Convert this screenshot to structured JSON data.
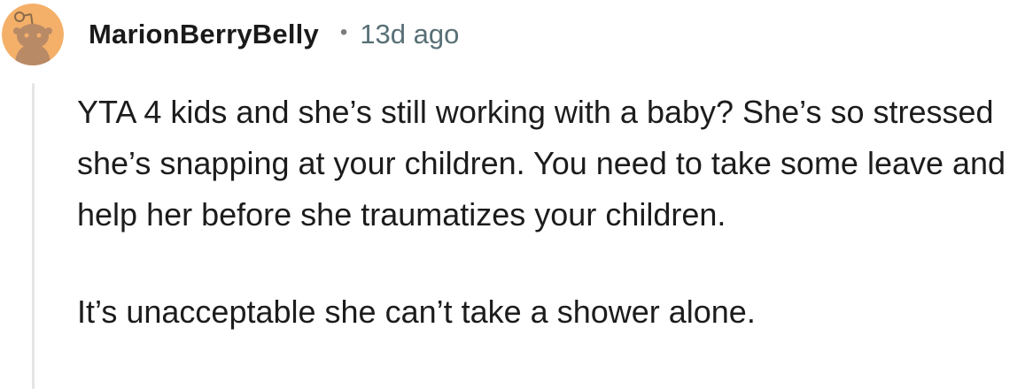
{
  "comment": {
    "author": "MarionBerryBelly",
    "separator": "•",
    "timestamp": "13d ago",
    "avatar_icon": "snoo-avatar-icon",
    "avatar_color": "#f4b069",
    "thread_line_color": "#e5e5e5",
    "paragraphs": [
      "YTA 4 kids and she’s still working with a baby? She’s so stressed she’s snapping at your children. You need to take some leave and help her before she traumatizes your children.",
      "It’s unacceptable she can’t take a shower alone."
    ]
  }
}
